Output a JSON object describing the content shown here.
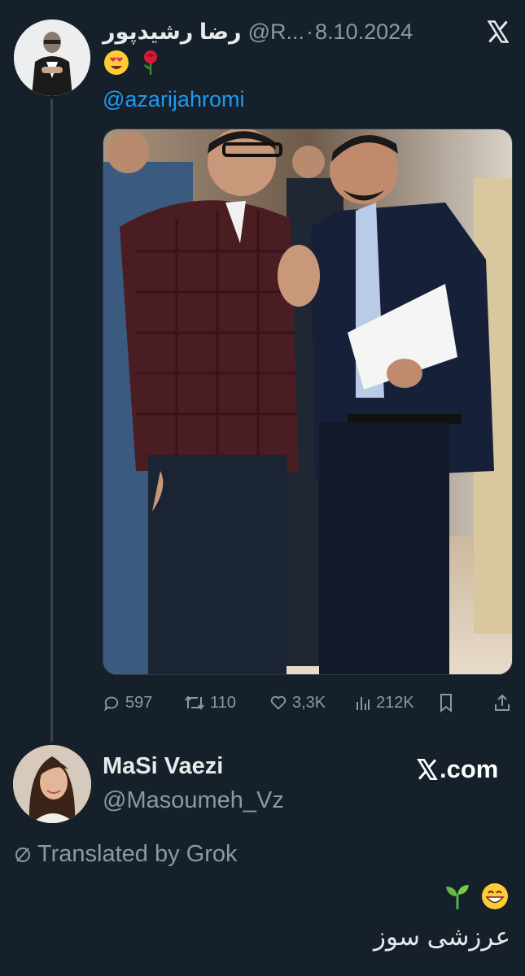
{
  "tweet": {
    "display_name": "رضا رشیدپور",
    "handle": "@R...",
    "separator": "·",
    "date": "8.10.2024",
    "emojis": [
      "heart-eyes-emoji",
      "rose-emoji"
    ],
    "mention": "@azarijahromi",
    "actions": {
      "replies": "597",
      "retweets": "110",
      "likes": "3,3K",
      "views": "212K"
    }
  },
  "reply": {
    "display_name": "MaSi Vaezi",
    "handle": "@Masoumeh_Vz",
    "watermark": ".com",
    "translated_label": "Translated by Grok",
    "emojis": [
      "seedling-emoji",
      "grin-emoji"
    ],
    "text": "عرزشی سوز"
  },
  "colors": {
    "background": "#15202b",
    "text": "#e7e9ea",
    "muted": "#8b98a5",
    "link": "#1d9bf0"
  }
}
